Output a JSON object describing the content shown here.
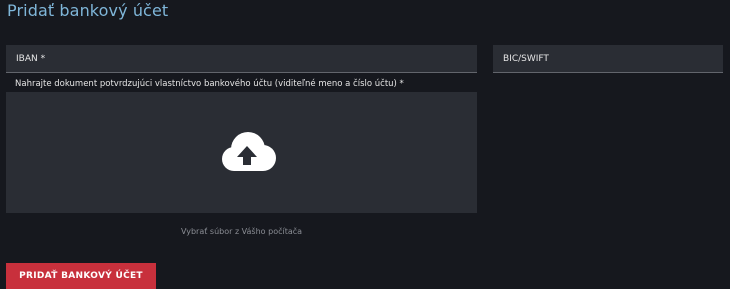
{
  "page": {
    "title": "Pridať bankový účet"
  },
  "form": {
    "iban_placeholder": "IBAN *",
    "bic_placeholder": "BIC/SWIFT",
    "upload_label": "Nahrajte dokument potvrdzujúci vlastníctvo bankového účtu (viditeľné meno a číslo účtu) *",
    "upload_icon": "cloud-upload-icon",
    "file_hint": "Vybrať súbor z Vášho počítača",
    "submit_label": "PRIDAŤ BANKOVÝ ÚČET"
  },
  "colors": {
    "background": "#16181e",
    "title": "#7fb6d9",
    "field_background": "#2a2d34",
    "primary_button": "#c8303c"
  }
}
